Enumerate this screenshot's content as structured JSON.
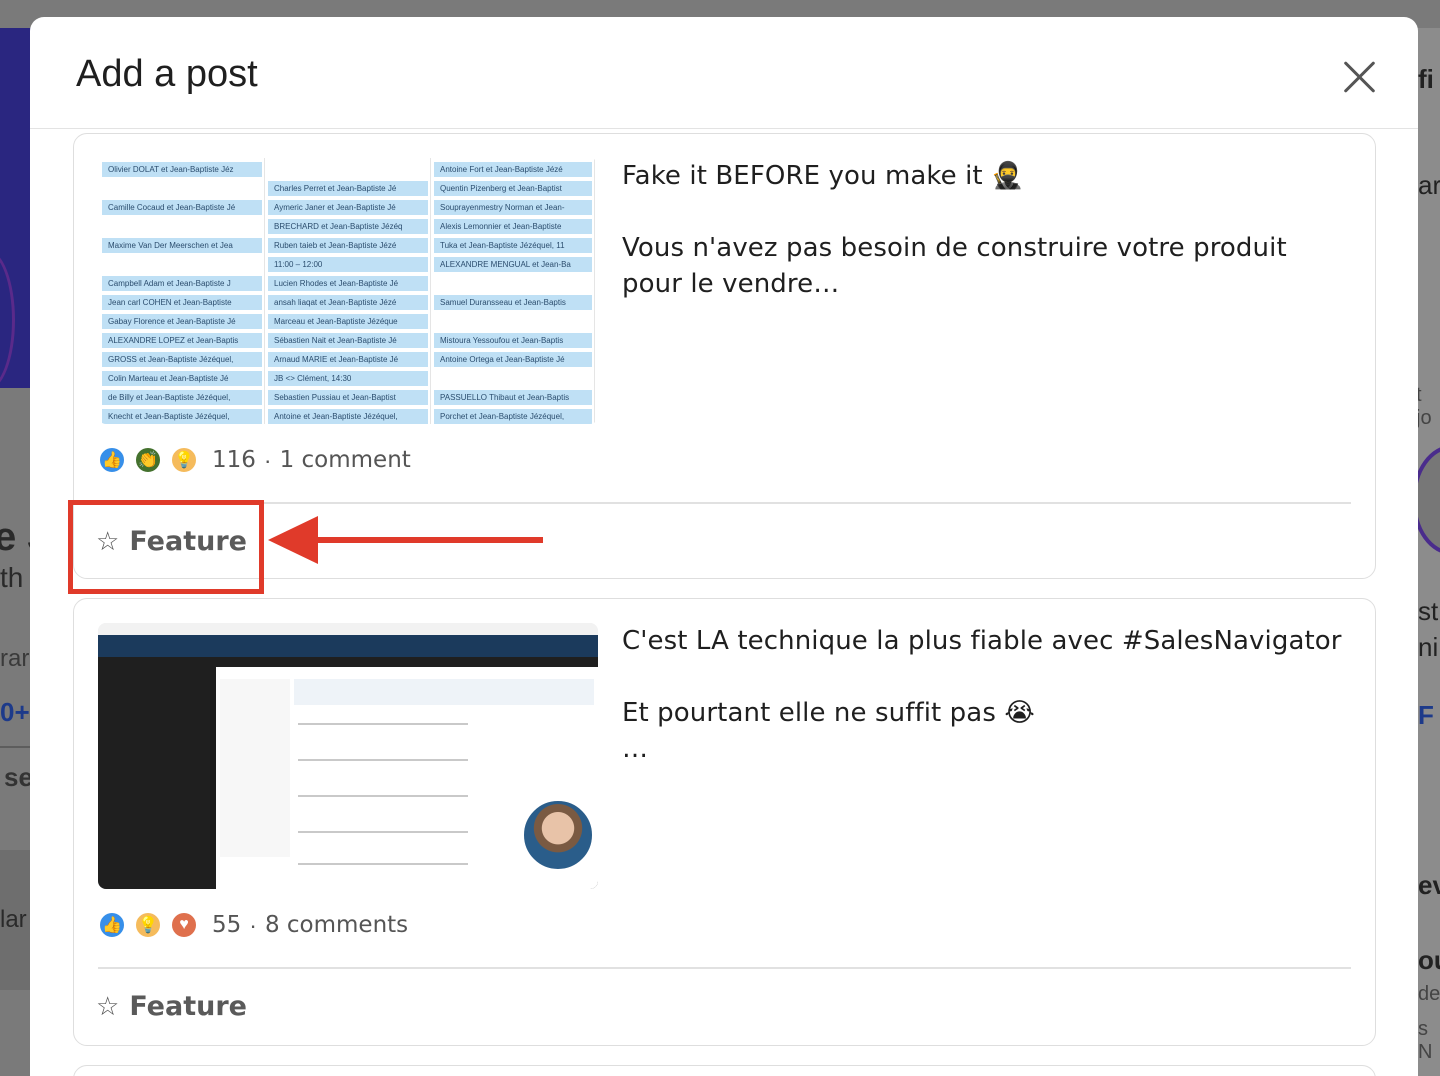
{
  "modal": {
    "title": "Add a post",
    "close_icon": "close-icon"
  },
  "posts": [
    {
      "text": "Fake it BEFORE you make it 🥷\n\nVous n'avez pas besoin de construire votre produit pour le vendre…",
      "reactions": [
        "like-icon",
        "celebrate-icon",
        "insightful-icon"
      ],
      "reaction_count": "116",
      "comments": "1 comment",
      "feature_label": "Feature",
      "sheet_col1": [
        "Olivier DOLAT et Jean-Baptiste Jéz",
        "",
        "Camille Cocaud et Jean-Baptiste Jé",
        "",
        "Maxime Van Der Meerschen et Jea",
        "",
        "Campbell Adam et Jean-Baptiste J",
        "Jean carl COHEN et Jean-Baptiste",
        "Gabay Florence et Jean-Baptiste Jé",
        "ALEXANDRE LOPEZ et Jean-Baptis",
        "GROSS et Jean-Baptiste Jézéquel,",
        "Colin Marteau et Jean-Baptiste Jé",
        "de Billy et Jean-Baptiste Jézéquel,",
        "Knecht et Jean-Baptiste Jézéquel,"
      ],
      "sheet_col2": [
        "",
        "Charles Perret et Jean-Baptiste Jé",
        "Aymeric Janer et Jean-Baptiste Jé",
        "BRECHARD et Jean-Baptiste Jézéq",
        "Ruben taieb et Jean-Baptiste Jézé",
        "11:00 – 12:00",
        "Lucien Rhodes et Jean-Baptiste Jé",
        "ansah liaqat et Jean-Baptiste Jézé",
        "Marceau et Jean-Baptiste Jézéque",
        "Sébastien Nait et Jean-Baptiste Jé",
        "Arnaud MARIE et Jean-Baptiste Jé",
        "JB <> Clément, 14:30",
        "Sebastien Pussiau et Jean-Baptist",
        "Antoine et Jean-Baptiste Jézéquel,"
      ],
      "sheet_col3": [
        "Antoine Fort et Jean-Baptiste Jézé",
        "Quentin Pizenberg et Jean-Baptist",
        "Souprayenmestry Norman et Jean-",
        "Alexis Lemonnier et Jean-Baptiste",
        "Tuka et Jean-Baptiste Jézéquel, 11",
        "ALEXANDRE MENGUAL et Jean-Ba",
        "",
        "Samuel Duransseau et Jean-Baptis",
        "",
        "Mistoura Yessoufou et Jean-Baptis",
        "Antoine Ortega et Jean-Baptiste Jé",
        "",
        "PASSUELLO Thibaut et Jean-Baptis",
        "Porchet et Jean-Baptiste Jézéquel,"
      ]
    },
    {
      "text": "C'est LA technique la plus fiable avec #SalesNavigator\n\nEt pourtant elle ne suffit pas 😭\n…",
      "reactions": [
        "like-icon",
        "insightful-icon",
        "love-icon"
      ],
      "reaction_count": "55",
      "comments": "8 comments",
      "feature_label": "Feature"
    }
  ],
  "background": {
    "left_fragments": [
      "e J",
      "th",
      "rar",
      "0+",
      "se",
      "lar"
    ],
    "right_fragments": [
      "fi",
      "ar",
      "t jo",
      "st",
      "ni",
      "F",
      "ev",
      "ou",
      "de",
      "s N"
    ]
  },
  "colors": {
    "annotation": "#e03a2a",
    "like": "#378fe9",
    "celebrate": "#44712e",
    "insightful": "#f5bb5c",
    "love": "#df704d"
  }
}
